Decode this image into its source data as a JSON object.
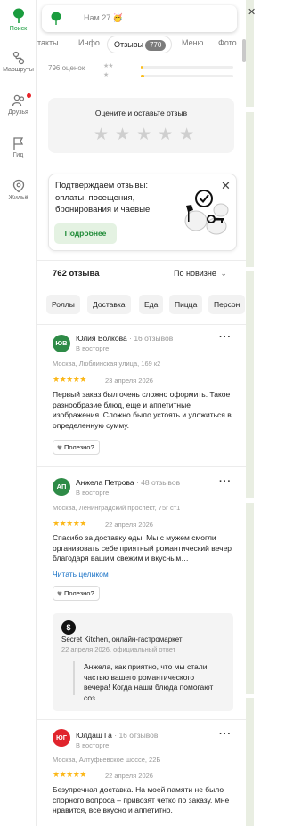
{
  "rail": {
    "items": [
      {
        "label": "Поиск"
      },
      {
        "label": "Маршруты"
      },
      {
        "label": "Друзья"
      },
      {
        "label": "Гид"
      },
      {
        "label": "Жильё"
      }
    ]
  },
  "search": {
    "text": "Нам 27 🥳"
  },
  "tabs": {
    "items": [
      "нтакты",
      "Инфо",
      "Отзывы",
      "Меню",
      "Фото"
    ],
    "reviews_count": "770"
  },
  "ratings": {
    "total_label": "796 оценок",
    "bar_fill_fraction": [
      0.02,
      0.04
    ]
  },
  "rate_prompt": {
    "title": "Оцените и оставьте отзыв",
    "stars": "★★★★★"
  },
  "promo": {
    "text": "Подтверждаем отзывы: оплаты, посещения, бронирования и чаевые",
    "button": "Подробнее",
    "close": "✕"
  },
  "reviews_header": {
    "count": "762 отзыва",
    "sort": "По новизне"
  },
  "chips": [
    "Роллы",
    "Доставка",
    "Еда",
    "Пицца",
    "Персон"
  ],
  "helpful_label": "Полезно?",
  "reviews": [
    {
      "initials": "ЮВ",
      "avatar_color": "#2e8b47",
      "name": "Юлия Волкова",
      "count": "· 16 отзывов",
      "status": "В восторге",
      "location": "Москва, Люблинская улица, 169 к2",
      "stars": "★★★★★",
      "date": "23 апреля 2026",
      "text": "Первый заказ был очень сложно оформить. Такое разнообразие блюд, еще и аппетитные изображения. Сложно было устоять и уложиться в определенную сумму."
    },
    {
      "initials": "АП",
      "avatar_color": "#2e8b47",
      "name": "Анжела Петрова",
      "count": "· 48 отзывов",
      "status": "В восторге",
      "location": "Москва, Ленинградский проспект, 75г ст1",
      "stars": "★★★★★",
      "date": "22 апреля 2026",
      "text": "Спасибо за доставку еды! Мы с мужем смогли организовать себе приятный романтический вечер благодаря вашим свежим и вкусным…",
      "read_more": "Читать целиком",
      "reply": {
        "org": "Secret Kitchen, онлайн-гастромаркет",
        "date": "22 апреля 2026, официальный ответ",
        "text": "Анжела, как приятно, что мы стали частью вашего романтического вечера! Когда наши блюда помогают соз…"
      }
    },
    {
      "initials": "ЮГ",
      "avatar_color": "#e0242c",
      "name": "Юлдаш Га",
      "count": "· 16 отзывов",
      "status": "В восторге",
      "location": "Москва, Алтуфьевское шоссе, 22Б",
      "stars": "★★★★★",
      "date": "22 апреля 2026",
      "text": "Безупречная доставка. На моей памяти не было спорного вопроса – привозят четко по заказу. Мне нравится, все вкусно и аппетитно."
    }
  ],
  "colors": {
    "brand_green": "#1a9c3e",
    "star_yellow": "#fbb718",
    "link_blue": "#1972c6"
  }
}
